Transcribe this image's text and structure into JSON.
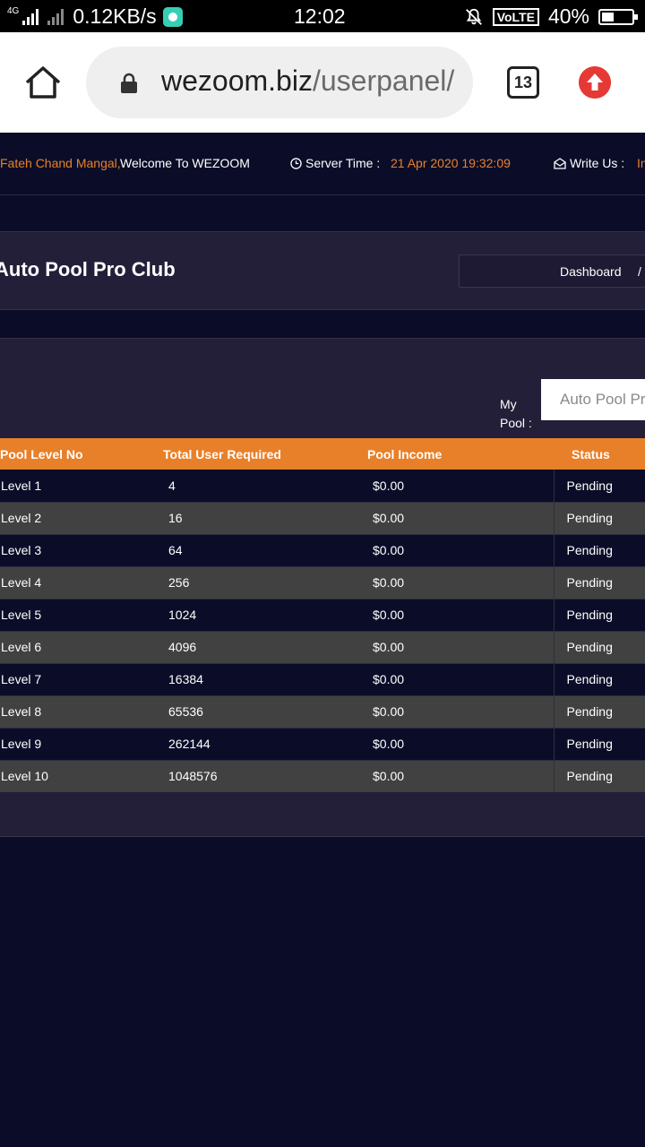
{
  "status_bar": {
    "network": "4G",
    "speed": "0.12KB/s",
    "time": "12:02",
    "volte": "VoLTE",
    "battery": "40%"
  },
  "browser": {
    "url_domain": "wezoom.biz",
    "url_path": "/userpanel/",
    "tab_count": "13"
  },
  "top_strip": {
    "user_name": "Fateh Chand Mangal,",
    "welcome": "Welcome To WEZOOM",
    "server_label": "Server Time  :",
    "server_time": "21 Apr 2020 19:32:09",
    "write_label": "Write Us  :",
    "write_value": "In"
  },
  "page": {
    "title": "Auto Pool Pro Club",
    "breadcrumb": "Dashboard",
    "breadcrumb_sep": "/"
  },
  "pool": {
    "label_line1": "My",
    "label_line2": "Pool :",
    "selected": "Auto Pool Pro Club"
  },
  "table": {
    "headers": [
      "Pool Level No",
      "Total User Required",
      "Pool Income",
      "Status"
    ],
    "rows": [
      [
        "Level 1",
        "4",
        "$0.00",
        "Pending"
      ],
      [
        "Level 2",
        "16",
        "$0.00",
        "Pending"
      ],
      [
        "Level 3",
        "64",
        "$0.00",
        "Pending"
      ],
      [
        "Level 4",
        "256",
        "$0.00",
        "Pending"
      ],
      [
        "Level 5",
        "1024",
        "$0.00",
        "Pending"
      ],
      [
        "Level 6",
        "4096",
        "$0.00",
        "Pending"
      ],
      [
        "Level 7",
        "16384",
        "$0.00",
        "Pending"
      ],
      [
        "Level 8",
        "65536",
        "$0.00",
        "Pending"
      ],
      [
        "Level 9",
        "262144",
        "$0.00",
        "Pending"
      ],
      [
        "Level 10",
        "1048576",
        "$0.00",
        "Pending"
      ]
    ]
  },
  "colors": {
    "accent_orange": "#e8802a",
    "page_bg": "#0b0d28",
    "panel_bg": "#231f39"
  }
}
